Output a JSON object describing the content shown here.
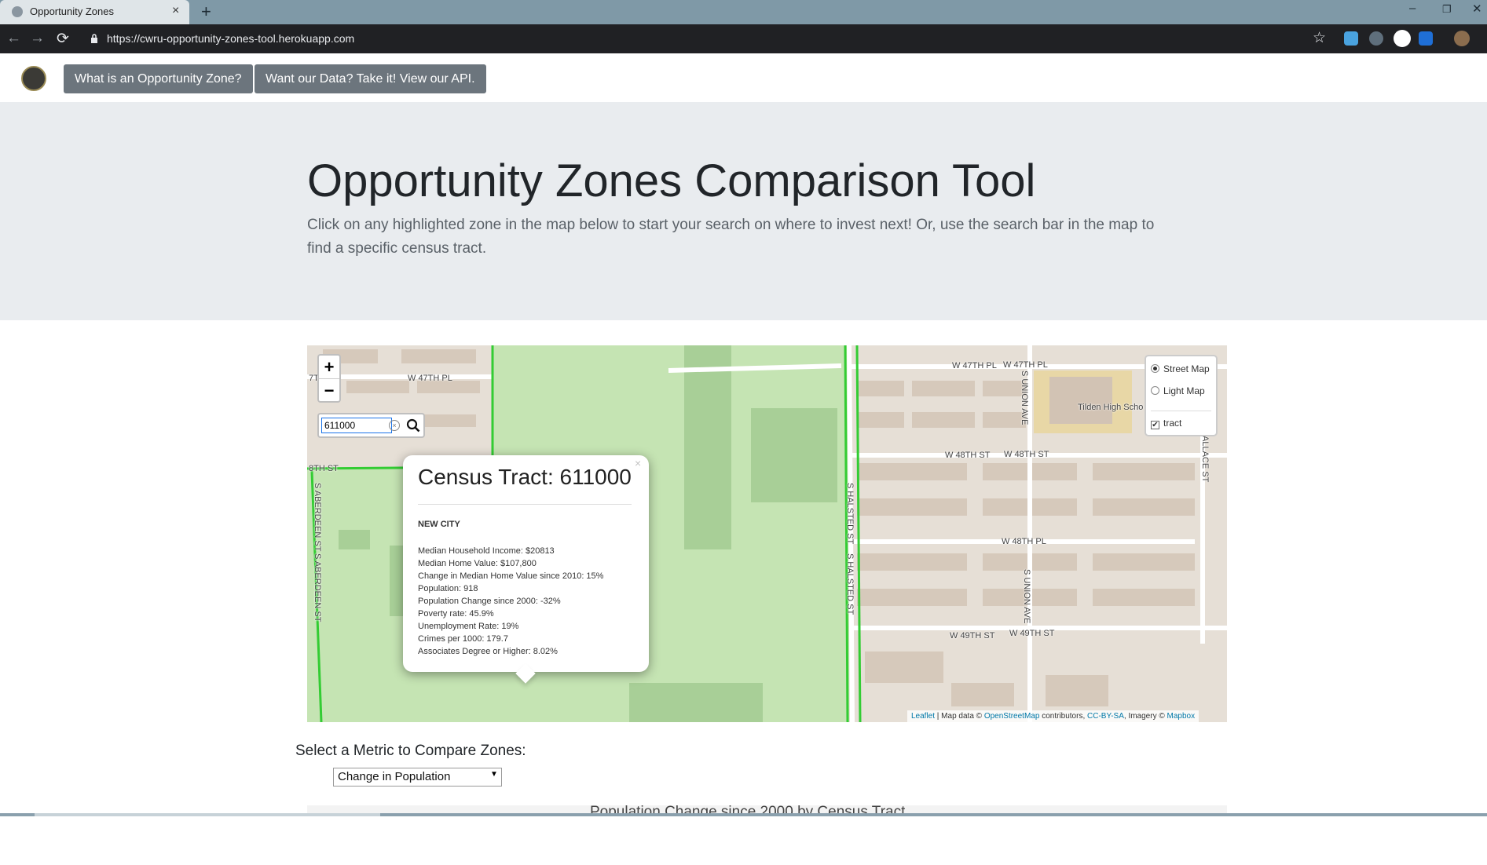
{
  "browser": {
    "tab_title": "Opportunity Zones",
    "tab_close": "×",
    "new_tab": "+",
    "url": "https://cwru-opportunity-zones-tool.herokuapp.com",
    "nav_back": "←",
    "nav_forward": "→",
    "nav_reload": "⟳",
    "star": "☆",
    "minimize": "–",
    "restore": "❐",
    "close": "✕"
  },
  "navbar": {
    "button_what": "What is an Opportunity Zone?",
    "button_api": "Want our Data? Take it! View our API."
  },
  "jumbotron": {
    "heading": "Opportunity Zones Comparison Tool",
    "lead": "Click on any highlighted zone in the map below to start your search on where to invest next! Or, use the search bar in the map to find a specific census tract."
  },
  "map": {
    "zoom_in": "+",
    "zoom_out": "−",
    "search_value": "611000",
    "search_clear": "×",
    "layers": {
      "street": "Street Map",
      "light": "Light Map",
      "tract": "tract",
      "tract_check": "✔"
    },
    "street_labels": {
      "w47th_left": "W 47TH PL",
      "w47th_r1": "W 47TH PL",
      "w47th_r2": "W 47TH PL",
      "w48st_left": "8TH ST",
      "w48st_r1": "W 48TH ST",
      "w48st_r2": "W 48TH ST",
      "w48pl": "W 48TH PL",
      "w49st_1": "W 49TH ST",
      "w49st_2": "W 49TH ST",
      "aberdeen_1": "S ABERDEEN ST",
      "aberdeen_2": "S ABERDEEN ST",
      "halsted_1": "S HALSTED ST",
      "halsted_2": "S HALSTED ST",
      "union_1": "S UNION AVE",
      "union_2": "S UNION AVE",
      "wallace": "ALLACE ST",
      "tilden": "Tilden High Scho",
      "corner": "7T"
    },
    "popup": {
      "close": "×",
      "title": "Census Tract: 611000",
      "area": "NEW CITY",
      "stats": [
        "Median Household Income: $20813",
        "Median Home Value: $107,800",
        "Change in Median Home Value since 2010: 15%",
        "Population: 918",
        "Population Change since 2000: -32%",
        "Poverty rate: 45.9%",
        "Unemployment Rate: 19%",
        "Crimes per 1000: 179.7",
        "Associates Degree or Higher: 8.02%"
      ]
    },
    "attribution": {
      "leaflet": "Leaflet",
      "sep1": " | Map data © ",
      "osm": "OpenStreetMap",
      "sep2": " contributors, ",
      "ccbysa": "CC-BY-SA",
      "sep3": ", Imagery © ",
      "mapbox": "Mapbox"
    }
  },
  "metric": {
    "label": "Select a Metric to Compare Zones:",
    "selected": "Change in Population",
    "arrow": "▼"
  },
  "chart": {
    "title": "Population Change since 2000 by Census Tract"
  },
  "colors": {
    "park": "#c5e4b3",
    "tract_border": "#33cc33",
    "nav_button": "#6c757d",
    "jumbotron": "#e9ecef"
  }
}
